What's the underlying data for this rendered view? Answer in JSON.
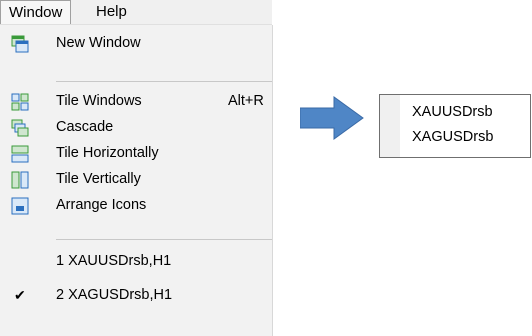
{
  "menubar": {
    "window_label": "Window",
    "help_label": "Help"
  },
  "menu": {
    "items": [
      {
        "label": "New Window",
        "icon": "new-window-icon"
      },
      {
        "label": "Tile Windows",
        "shortcut": "Alt+R",
        "icon": "tile-windows-icon"
      },
      {
        "label": "Cascade",
        "icon": "cascade-icon"
      },
      {
        "label": "Tile Horizontally",
        "icon": "tile-horizontally-icon"
      },
      {
        "label": "Tile Vertically",
        "icon": "tile-vertically-icon"
      },
      {
        "label": "Arrange Icons",
        "icon": "arrange-icons-icon"
      },
      {
        "label": "1 XAUUSDrsb,H1"
      },
      {
        "label": "2 XAGUSDrsb,H1",
        "checked": true
      }
    ]
  },
  "panel": {
    "items": [
      "XAUUSDrsb",
      "XAGUSDrsb"
    ]
  },
  "colors": {
    "arrow": "#4f86c6",
    "icon_green": "#3a9a3a",
    "icon_blue": "#2a6fbf"
  }
}
